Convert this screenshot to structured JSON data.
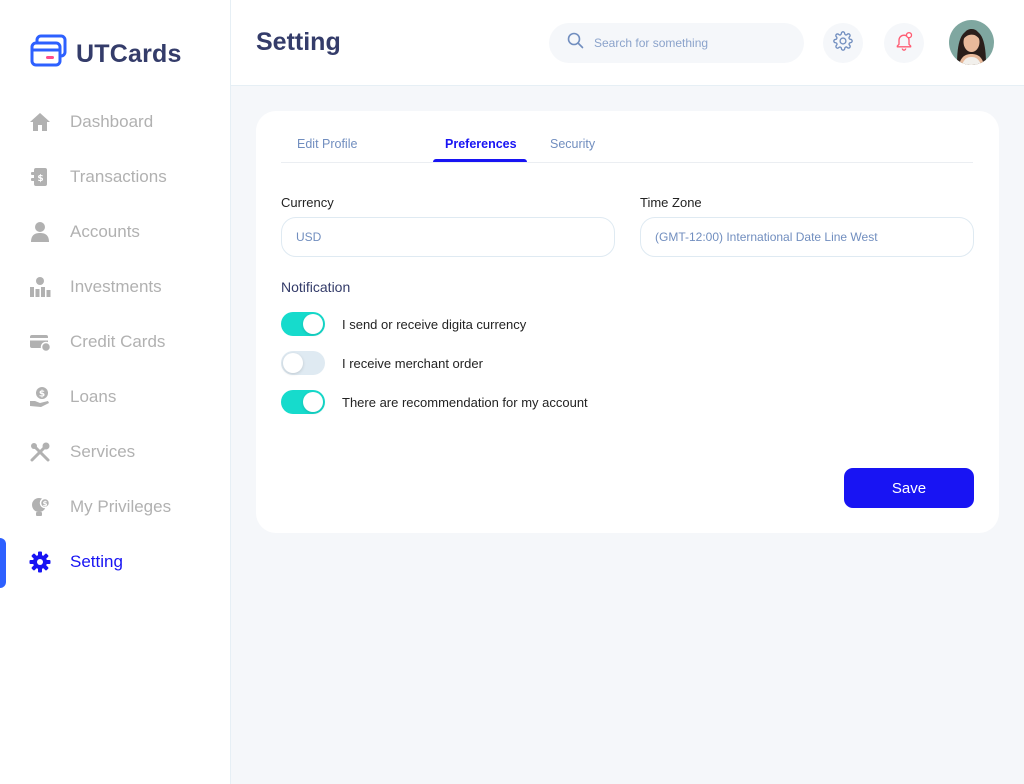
{
  "app": {
    "name": "UTCards",
    "brand_color": "#343C6A",
    "accent_color": "#1814F3"
  },
  "sidebar": {
    "items": [
      {
        "label": "Dashboard",
        "icon": "home-icon",
        "active": false
      },
      {
        "label": "Transactions",
        "icon": "transfer-icon",
        "active": false
      },
      {
        "label": "Accounts",
        "icon": "user-icon",
        "active": false
      },
      {
        "label": "Investments",
        "icon": "investment-icon",
        "active": false
      },
      {
        "label": "Credit Cards",
        "icon": "credit-card-icon",
        "active": false
      },
      {
        "label": "Loans",
        "icon": "loan-icon",
        "active": false
      },
      {
        "label": "Services",
        "icon": "service-icon",
        "active": false
      },
      {
        "label": "My Privileges",
        "icon": "privilege-icon",
        "active": false
      },
      {
        "label": "Setting",
        "icon": "gear-icon",
        "active": true
      }
    ]
  },
  "header": {
    "title": "Setting",
    "search_placeholder": "Search for something",
    "settings_icon": "gear-icon",
    "notification_icon": "bell-icon"
  },
  "tabs": [
    {
      "label": "Edit Profile",
      "active": false
    },
    {
      "label": "Preferences",
      "active": true
    },
    {
      "label": "Security",
      "active": false
    }
  ],
  "form": {
    "currency": {
      "label": "Currency",
      "value": "USD"
    },
    "timezone": {
      "label": "Time Zone",
      "value": "(GMT-12:00) International Date Line West"
    }
  },
  "notification": {
    "title": "Notification",
    "options": [
      {
        "label": "I send or receive digita currency",
        "enabled": true
      },
      {
        "label": "I receive merchant order",
        "enabled": false
      },
      {
        "label": "There are recommendation for my account",
        "enabled": true
      }
    ]
  },
  "colors": {
    "toggle_on": "#16DBCC",
    "toggle_off": "#DFEAF2"
  },
  "actions": {
    "save_label": "Save"
  }
}
